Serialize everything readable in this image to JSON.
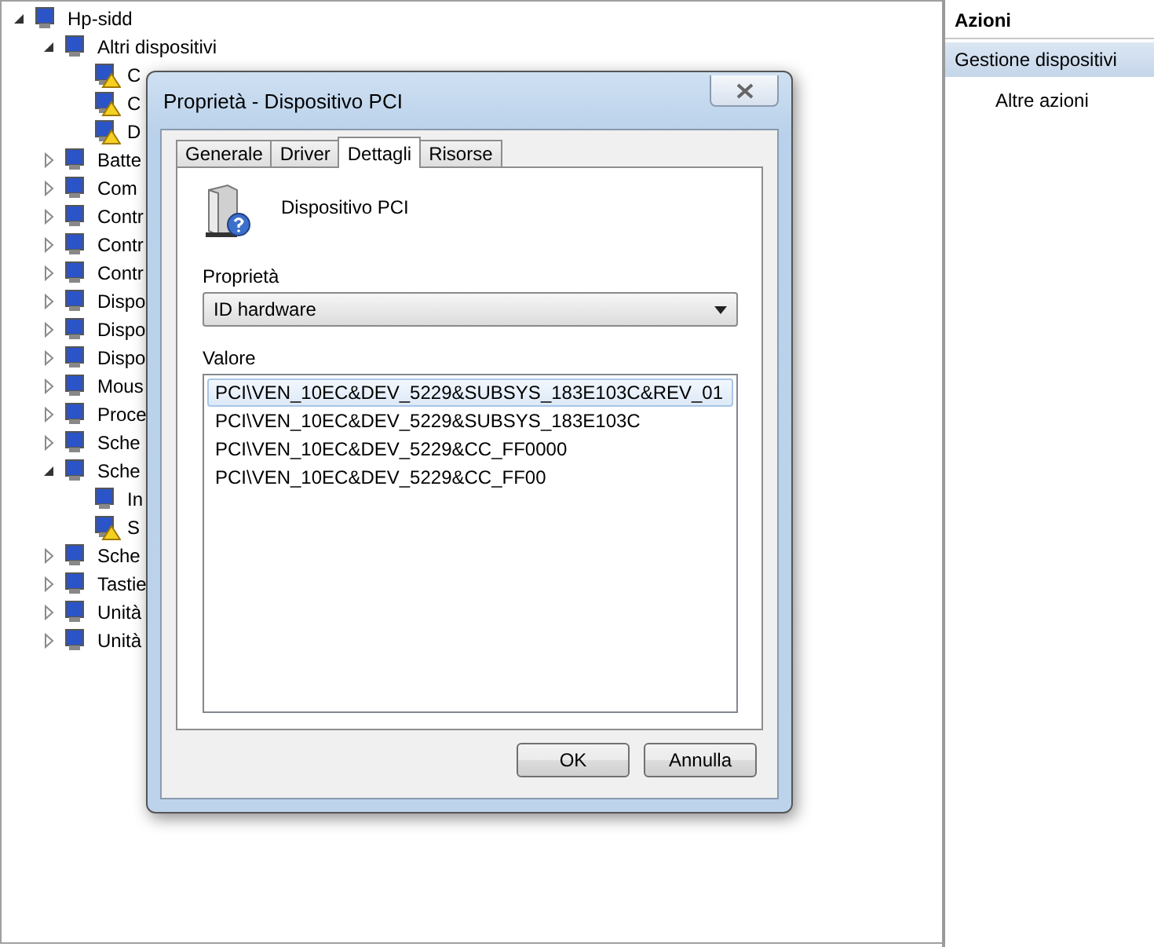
{
  "tree": [
    {
      "label": "Hp-sidd",
      "expanded": true,
      "children": [
        {
          "label": "Altri dispositivi",
          "expanded": true,
          "children": [
            {
              "label": "C",
              "warning": true
            },
            {
              "label": "C",
              "warning": true
            },
            {
              "label": "D",
              "warning": true
            }
          ]
        },
        {
          "label": "Batte",
          "expanded": false
        },
        {
          "label": "Com",
          "expanded": false
        },
        {
          "label": "Contr",
          "expanded": false
        },
        {
          "label": "Contr",
          "expanded": false
        },
        {
          "label": "Contr",
          "expanded": false
        },
        {
          "label": "Dispo",
          "expanded": false
        },
        {
          "label": "Dispo",
          "expanded": false
        },
        {
          "label": "Dispo",
          "expanded": false
        },
        {
          "label": "Mous",
          "expanded": false
        },
        {
          "label": "Proce",
          "expanded": false
        },
        {
          "label": "Sche",
          "expanded": false
        },
        {
          "label": "Sche",
          "expanded": true,
          "children": [
            {
              "label": "In",
              "warning": false
            },
            {
              "label": "S",
              "warning": true
            }
          ]
        },
        {
          "label": "Sche",
          "expanded": false
        },
        {
          "label": "Tastie",
          "expanded": false
        },
        {
          "label": "Unità",
          "expanded": false
        },
        {
          "label": "Unità",
          "expanded": false
        }
      ]
    }
  ],
  "actions": {
    "title": "Azioni",
    "items": [
      {
        "label": "Gestione dispositivi",
        "kind": "header"
      },
      {
        "label": "Altre azioni",
        "kind": "link"
      }
    ]
  },
  "dialog": {
    "title": "Proprietà - Dispositivo PCI",
    "tabs": [
      {
        "label": "Generale",
        "selected": false
      },
      {
        "label": "Driver",
        "selected": false
      },
      {
        "label": "Dettagli",
        "selected": true
      },
      {
        "label": "Risorse",
        "selected": false
      }
    ],
    "device_name": "Dispositivo PCI",
    "property_label": "Proprietà",
    "property_value": "ID hardware",
    "value_label": "Valore",
    "values": [
      {
        "text": "PCI\\VEN_10EC&DEV_5229&SUBSYS_183E103C&REV_01",
        "selected": true
      },
      {
        "text": "PCI\\VEN_10EC&DEV_5229&SUBSYS_183E103C",
        "selected": false
      },
      {
        "text": "PCI\\VEN_10EC&DEV_5229&CC_FF0000",
        "selected": false
      },
      {
        "text": "PCI\\VEN_10EC&DEV_5229&CC_FF00",
        "selected": false
      }
    ],
    "buttons": [
      "OK",
      "Annulla"
    ]
  }
}
